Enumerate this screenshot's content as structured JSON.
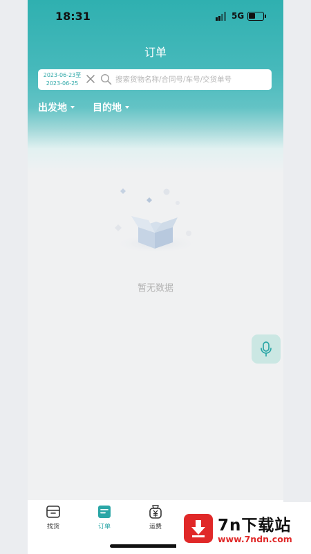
{
  "status_bar": {
    "time": "18:31",
    "network": "5G"
  },
  "header": {
    "title": "订单"
  },
  "search": {
    "date_start": "2023-06-23至",
    "date_end": "2023-06-25",
    "placeholder": "搜索货物名称/合同号/车号/交货单号"
  },
  "filters": {
    "origin": "出发地",
    "destination": "目的地"
  },
  "empty_state": {
    "message": "暂无数据"
  },
  "tabbar": {
    "items": [
      {
        "label": "找货",
        "icon": "cargo-box-icon"
      },
      {
        "label": "订单",
        "icon": "order-list-icon",
        "active": true
      },
      {
        "label": "运费",
        "icon": "freight-fee-icon"
      }
    ]
  },
  "watermark": {
    "title": "7n下载站",
    "url": "www.7ndn.com"
  },
  "colors": {
    "accent": "#2aa6a6",
    "header_top": "#2fb0b0",
    "voice_button_bg": "#cbe7e3",
    "watermark_red": "#e02828"
  }
}
